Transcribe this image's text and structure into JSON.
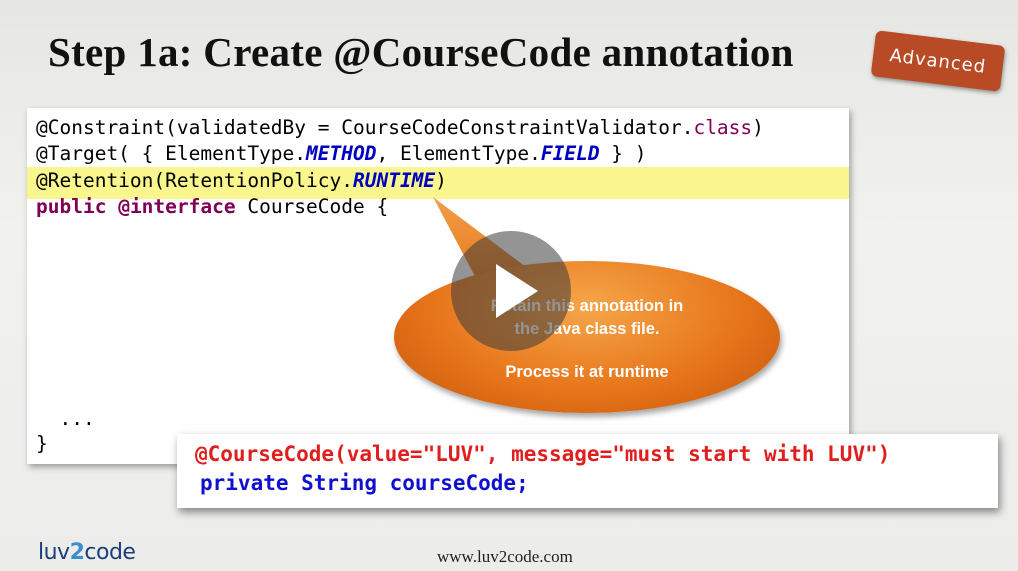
{
  "slide": {
    "title": "Step 1a: Create @CourseCode annotation",
    "badge": "Advanced",
    "footer_url": "www.luv2code.com",
    "logo": {
      "part1": "luv",
      "part2": "2",
      "part3": "code"
    }
  },
  "code": {
    "line1_a": "@Constraint(validatedBy = CourseCodeConstraintValidator.",
    "line1_kw": "class",
    "line1_b": ")",
    "line2_a": "@Target( { ElementType.",
    "line2_it1": "METHOD",
    "line2_b": ", ElementType.",
    "line2_it2": "FIELD",
    "line2_c": " } )",
    "line3_a": "@Retention(RetentionPolicy.",
    "line3_it": "RUNTIME",
    "line3_b": ")",
    "line4_kw1": "public",
    "line4_kw2": "@interface",
    "line4_rest": " CourseCode {",
    "line5": "  ...",
    "line6": "}"
  },
  "callout": {
    "line1": "Retain this annotation in",
    "line2": "the Java class file.",
    "line3": "Process it at runtime"
  },
  "usage": {
    "line1": "@CourseCode(value=\"LUV\", message=\"must start with LUV\")",
    "line2": "private String courseCode;"
  },
  "colors": {
    "badge": "#b94a26",
    "highlight": "#f8f68c",
    "callout": "#e8761b"
  },
  "icons": {
    "play": "play-icon"
  }
}
